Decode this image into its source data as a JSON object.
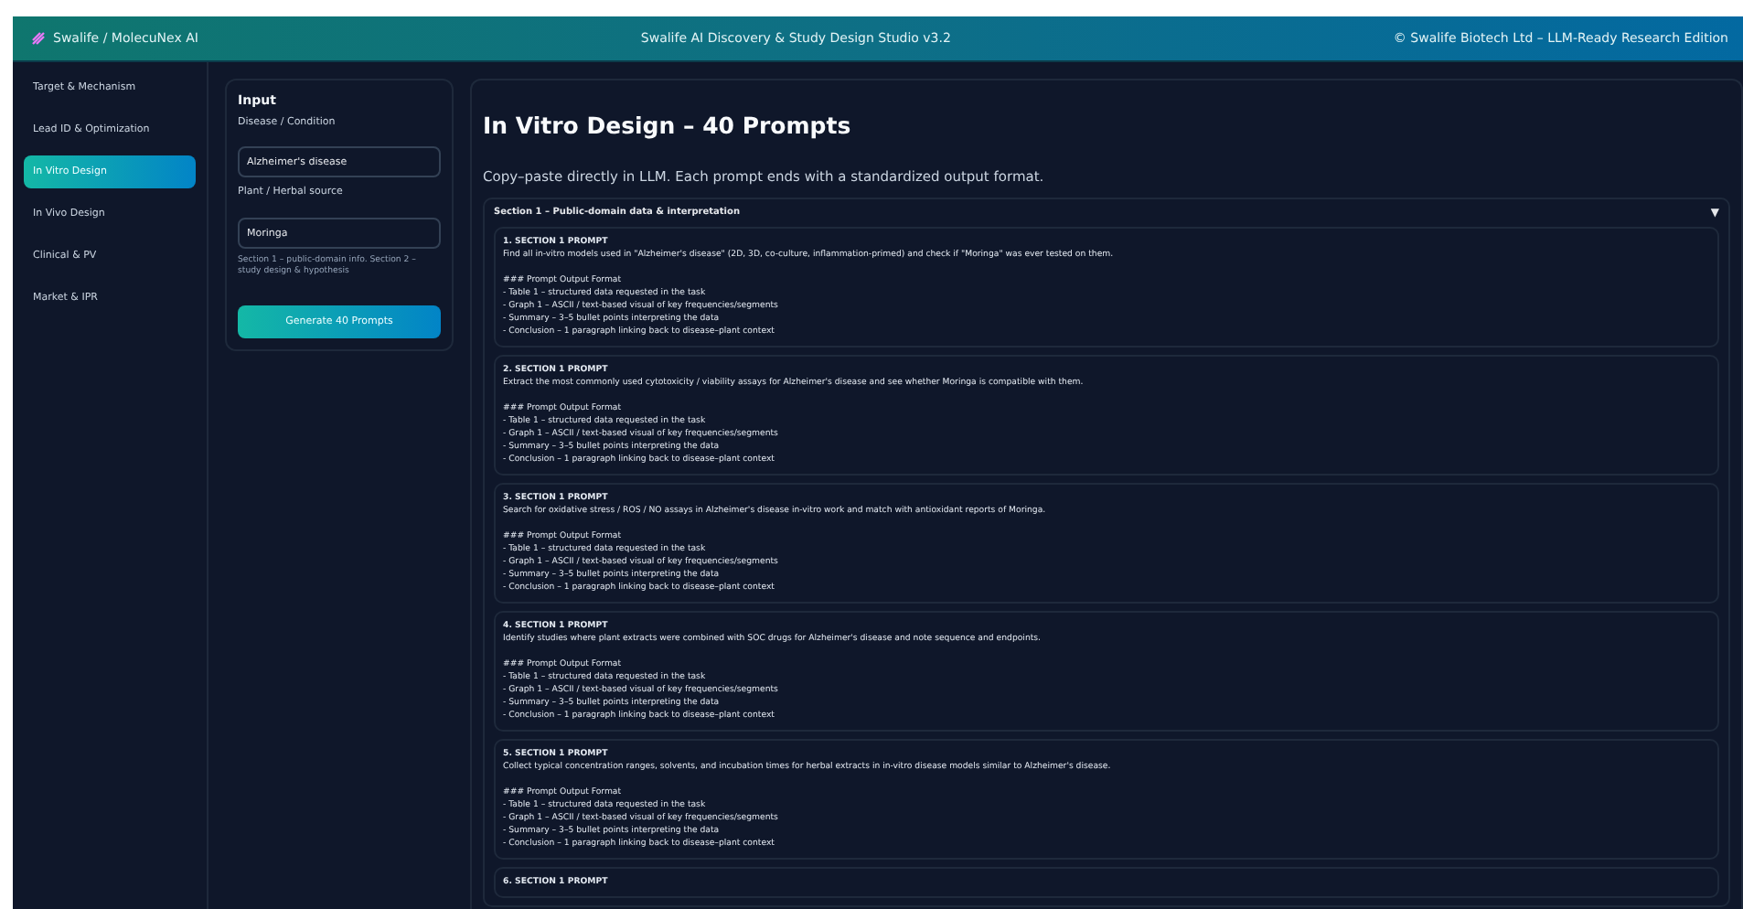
{
  "header": {
    "brand": "Swalife / MolecuNex AI",
    "title": "Swalife AI Discovery & Study Design Studio v3.2",
    "copyright": "© Swalife Biotech Ltd – LLM-Ready Research Edition"
  },
  "sidebar": {
    "items": [
      {
        "label": "Target & Mechanism",
        "selected": false
      },
      {
        "label": "Lead ID & Optimization",
        "selected": false
      },
      {
        "label": "In Vitro Design",
        "selected": true
      },
      {
        "label": "In Vivo Design",
        "selected": false
      },
      {
        "label": "Clinical & PV",
        "selected": false
      },
      {
        "label": "Market & IPR",
        "selected": false
      }
    ]
  },
  "input_panel": {
    "title": "Input",
    "fields": [
      {
        "label": "Disease / Condition",
        "value": "Alzheimer's disease"
      },
      {
        "label": "Plant / Herbal source",
        "value": "Moringa"
      }
    ],
    "help": "Section 1 – public-domain info. Section 2 – study design & hypothesis",
    "button": "Generate 40 Prompts"
  },
  "main": {
    "title": "In Vitro Design – 40 Prompts",
    "subtitle": "Copy–paste directly in LLM. Each prompt ends with a standardized output format.",
    "section": {
      "title": "Section 1 – Public-domain data & interpretation",
      "toggle": "▼",
      "expanded": true
    },
    "prompts": [
      {
        "title": "1. SECTION 1 PROMPT",
        "text": "Find all in-vitro models used in \"Alzheimer's disease\" (2D, 3D, co-culture, inflammation-primed) and check if \"Moringa\" was ever tested on them.",
        "format_title": "### Prompt Output Format",
        "format_lines": [
          "- Table 1 – structured data requested in the task",
          "- Graph 1 – ASCII / text-based visual of key frequencies/segments",
          "- Summary – 3–5 bullet points interpreting the data",
          "- Conclusion – 1 paragraph linking back to disease–plant context"
        ]
      },
      {
        "title": "2. SECTION 1 PROMPT",
        "text": "Extract the most commonly used cytotoxicity / viability assays for Alzheimer's disease and see whether Moringa is compatible with them.",
        "format_title": "### Prompt Output Format",
        "format_lines": [
          "- Table 1 – structured data requested in the task",
          "- Graph 1 – ASCII / text-based visual of key frequencies/segments",
          "- Summary – 3–5 bullet points interpreting the data",
          "- Conclusion – 1 paragraph linking back to disease–plant context"
        ]
      },
      {
        "title": "3. SECTION 1 PROMPT",
        "text": "Search for oxidative stress / ROS / NO assays in Alzheimer's disease in-vitro work and match with antioxidant reports of Moringa.",
        "format_title": "### Prompt Output Format",
        "format_lines": [
          "- Table 1 – structured data requested in the task",
          "- Graph 1 – ASCII / text-based visual of key frequencies/segments",
          "- Summary – 3–5 bullet points interpreting the data",
          "- Conclusion – 1 paragraph linking back to disease–plant context"
        ]
      },
      {
        "title": "4. SECTION 1 PROMPT",
        "text": "Identify studies where plant extracts were combined with SOC drugs for Alzheimer's disease and note sequence and endpoints.",
        "format_title": "### Prompt Output Format",
        "format_lines": [
          "- Table 1 – structured data requested in the task",
          "- Graph 1 – ASCII / text-based visual of key frequencies/segments",
          "- Summary – 3–5 bullet points interpreting the data",
          "- Conclusion – 1 paragraph linking back to disease–plant context"
        ]
      },
      {
        "title": "5. SECTION 1 PROMPT",
        "text": "Collect typical concentration ranges, solvents, and incubation times for herbal extracts in in-vitro disease models similar to Alzheimer's disease.",
        "format_title": "### Prompt Output Format",
        "format_lines": [
          "- Table 1 – structured data requested in the task",
          "- Graph 1 – ASCII / text-based visual of key frequencies/segments",
          "- Summary – 3–5 bullet points interpreting the data",
          "- Conclusion – 1 paragraph linking back to disease–plant context"
        ]
      },
      {
        "title": "6. SECTION 1 PROMPT"
      }
    ]
  }
}
